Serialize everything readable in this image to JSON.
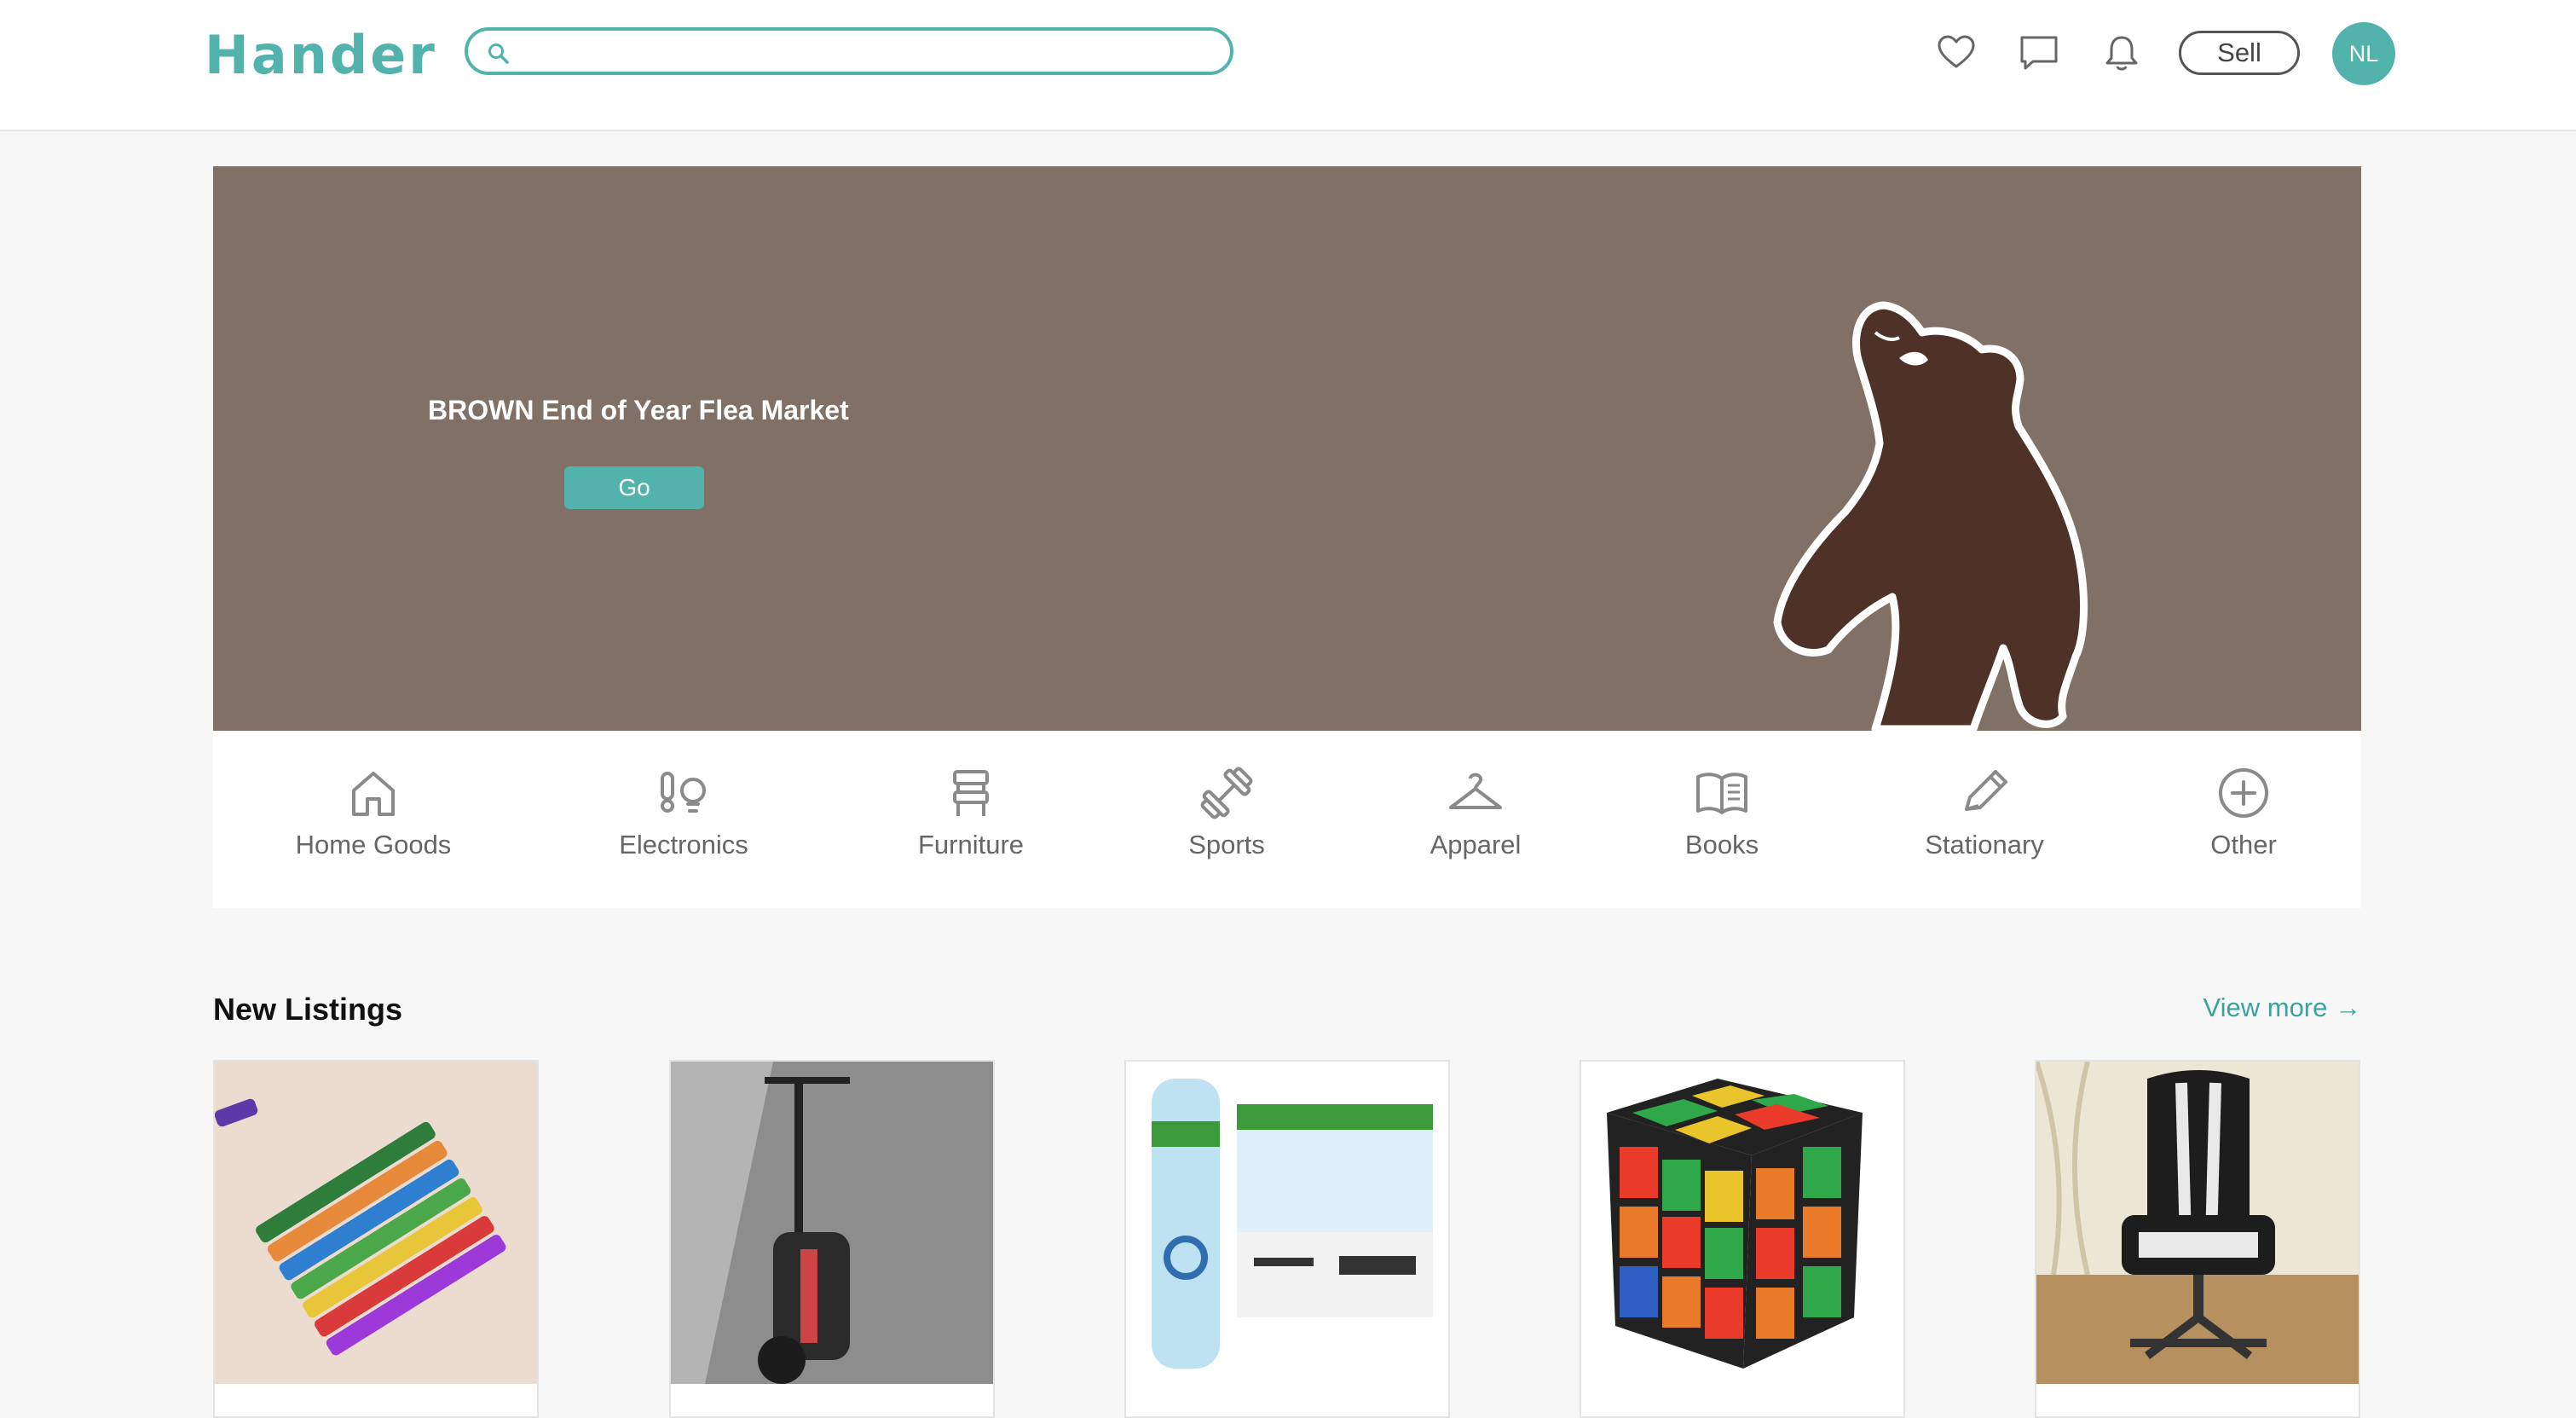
{
  "header": {
    "logo": "Hander",
    "search_placeholder": "",
    "icons": [
      "heart-icon",
      "chat-icon",
      "bell-icon"
    ],
    "sell_label": "Sell",
    "avatar_initials": "NL"
  },
  "banner": {
    "title": "BROWN End of Year Flea Market",
    "go_label": "Go",
    "background": "#807065"
  },
  "categories": [
    {
      "label": "Home Goods",
      "icon": "house-icon"
    },
    {
      "label": "Electronics",
      "icon": "electronics-icon"
    },
    {
      "label": "Furniture",
      "icon": "chair-icon"
    },
    {
      "label": "Sports",
      "icon": "dumbbell-icon"
    },
    {
      "label": "Apparel",
      "icon": "hanger-icon"
    },
    {
      "label": "Books",
      "icon": "book-icon"
    },
    {
      "label": "Stationary",
      "icon": "pencil-icon"
    },
    {
      "label": "Other",
      "icon": "plus-circle-icon"
    }
  ],
  "listings_section": {
    "title": "New Listings",
    "view_more": "View more →"
  },
  "listings": [
    {
      "image": "crayons",
      "caption": ""
    },
    {
      "image": "electric scooter",
      "caption": ""
    },
    {
      "image": "core water bottles",
      "caption": ""
    },
    {
      "image": "rubik's cube",
      "caption": ""
    },
    {
      "image": "gaming chair",
      "caption": ""
    }
  ],
  "colors": {
    "accent": "#52b3ad",
    "banner": "#807065",
    "bear": "#4f3227"
  }
}
